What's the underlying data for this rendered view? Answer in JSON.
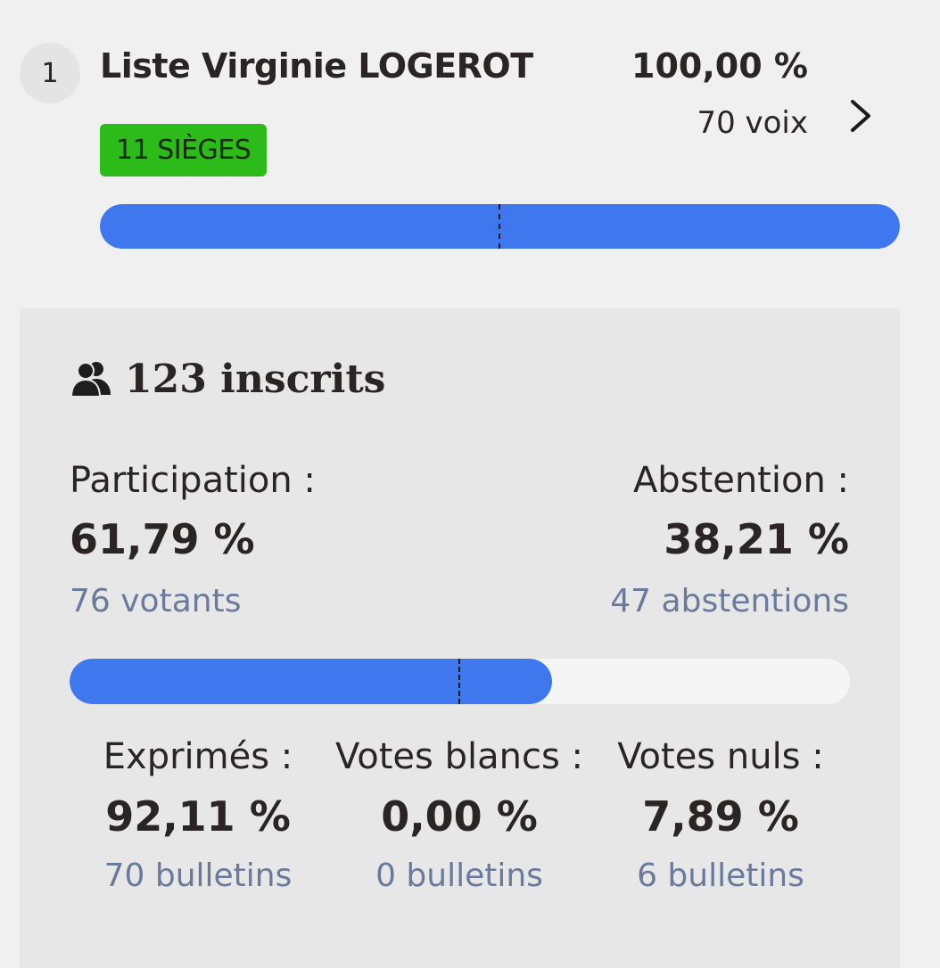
{
  "result": {
    "rank": "1",
    "list_name": "Liste Virginie LOGEROT",
    "percent": "100,00 %",
    "votes": "70 voix",
    "seats_badge": "11 SIÈGES",
    "bar_fraction": 1.0,
    "colors": {
      "bar": "#3f78ee",
      "badge": "#2dbb1a"
    }
  },
  "panel": {
    "registered": "123 inscrits",
    "registered_icon": "users-icon",
    "participation": {
      "label": "Participation :",
      "percent": "61,79 %",
      "count": "76 votants"
    },
    "abstention": {
      "label": "Abstention :",
      "percent": "38,21 %",
      "count": "47 abstentions"
    },
    "participation_bar_fraction": 0.6179,
    "expressed": {
      "label": "Exprimés :",
      "percent": "92,11 %",
      "count": "70 bulletins"
    },
    "blank": {
      "label": "Votes blancs :",
      "percent": "0,00 %",
      "count": "0 bulletins"
    },
    "null": {
      "label": "Votes nuls :",
      "percent": "7,89 %",
      "count": "6 bulletins"
    }
  }
}
